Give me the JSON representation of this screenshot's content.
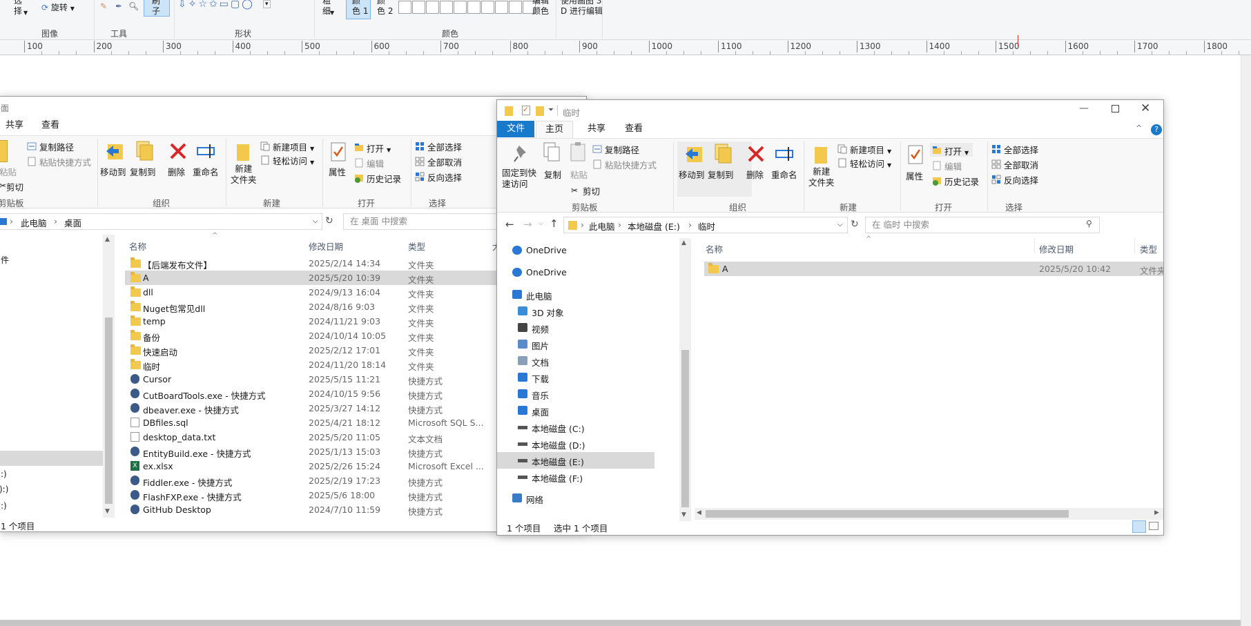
{
  "paint": {
    "select_label": "选\n择",
    "rotate_label": "旋转",
    "brush_label": "刷\n子",
    "thickness_label": "粗\n细",
    "color1_label": "颜\n色 1",
    "color2_label": "颜\n色 2",
    "edit_colors_label": "编辑\n颜色",
    "paint3d_label": "使用画图 3\nD 进行编辑",
    "groups": {
      "image": "图像",
      "tools": "工具",
      "shapes": "形状",
      "colors": "颜色"
    },
    "ruler_ticks": [
      "100",
      "200",
      "300",
      "400",
      "500",
      "600",
      "700",
      "800",
      "900",
      "1000",
      "1100",
      "1200",
      "1300",
      "1400",
      "1500",
      "1600",
      "1700",
      "1800"
    ]
  },
  "left_window": {
    "title_partial": "面",
    "tabs": [
      "共享",
      "查看"
    ],
    "ribbon": {
      "copy_path": "复制路径",
      "paste_shortcut": "粘贴快捷方式",
      "paste": "粘贴",
      "cut": "剪切",
      "clipboard_group": "剪贴板",
      "move_to": "移动到",
      "copy_to": "复制到",
      "delete": "删除",
      "rename": "重命名",
      "organize_group": "组织",
      "new_folder": "新建\n文件夹",
      "new_item": "新建项目",
      "easy_access": "轻松访问",
      "new_group": "新建",
      "properties": "属性",
      "open": "打开",
      "edit": "编辑",
      "history": "历史记录",
      "open_group": "打开",
      "select_all": "全部选择",
      "select_none": "全部取消",
      "invert_select": "反向选择",
      "select_group": "选择"
    },
    "breadcrumb": [
      "此电脑",
      "桌面"
    ],
    "search_placeholder": "在 桌面 中搜索",
    "columns": {
      "name": "名称",
      "date": "修改日期",
      "type": "类型",
      "size": "大"
    },
    "files": [
      {
        "name": "【后端发布文件】",
        "date": "2025/2/14 14:34",
        "type": "文件夹",
        "kind": "folder"
      },
      {
        "name": "A",
        "date": "2025/5/20 10:39",
        "type": "文件夹",
        "kind": "folder"
      },
      {
        "name": "dll",
        "date": "2024/9/13 16:04",
        "type": "文件夹",
        "kind": "folder"
      },
      {
        "name": "Nuget包常见dll",
        "date": "2024/8/16 9:03",
        "type": "文件夹",
        "kind": "folder"
      },
      {
        "name": "temp",
        "date": "2024/11/21 9:03",
        "type": "文件夹",
        "kind": "folder"
      },
      {
        "name": "备份",
        "date": "2024/10/14 10:05",
        "type": "文件夹",
        "kind": "folder"
      },
      {
        "name": "快速启动",
        "date": "2025/2/12 17:01",
        "type": "文件夹",
        "kind": "folder"
      },
      {
        "name": "临时",
        "date": "2024/11/20 18:14",
        "type": "文件夹",
        "kind": "folder"
      },
      {
        "name": "Cursor",
        "date": "2025/5/15 11:21",
        "type": "快捷方式",
        "kind": "shortcut"
      },
      {
        "name": "CutBoardTools.exe - 快捷方式",
        "date": "2024/10/15 9:56",
        "type": "快捷方式",
        "kind": "shortcut"
      },
      {
        "name": "dbeaver.exe - 快捷方式",
        "date": "2025/3/27 14:12",
        "type": "快捷方式",
        "kind": "shortcut"
      },
      {
        "name": "DBfiles.sql",
        "date": "2025/4/21 18:12",
        "type": "Microsoft SQL S...",
        "kind": "file"
      },
      {
        "name": "desktop_data.txt",
        "date": "2025/5/20 11:05",
        "type": "文本文档",
        "kind": "file"
      },
      {
        "name": "EntityBuild.exe - 快捷方式",
        "date": "2025/1/13 15:03",
        "type": "快捷方式",
        "kind": "shortcut"
      },
      {
        "name": "ex.xlsx",
        "date": "2025/2/26 15:24",
        "type": "Microsoft Excel ...",
        "kind": "excel"
      },
      {
        "name": "Fiddler.exe - 快捷方式",
        "date": "2025/2/19 17:23",
        "type": "快捷方式",
        "kind": "shortcut"
      },
      {
        "name": "FlashFXP.exe - 快捷方式",
        "date": "2025/5/6 18:00",
        "type": "快捷方式",
        "kind": "shortcut"
      },
      {
        "name": "GitHub Desktop",
        "date": "2024/7/10 11:59",
        "type": "快捷方式",
        "kind": "shortcut"
      }
    ],
    "nav_partial": [
      "件",
      ":)",
      "):)",
      ":)"
    ],
    "status": "1 个项目"
  },
  "right_window": {
    "title": "临时",
    "tabs": {
      "file": "文件",
      "home": "主页",
      "share": "共享",
      "view": "查看"
    },
    "ribbon": {
      "pin": "固定到快\n速访问",
      "copy": "复制",
      "paste": "粘贴",
      "copy_path": "复制路径",
      "paste_shortcut": "粘贴快捷方式",
      "cut": "剪切",
      "clipboard_group": "剪贴板",
      "move_to": "移动到",
      "copy_to": "复制到",
      "delete": "删除",
      "rename": "重命名",
      "organize_group": "组织",
      "new_folder": "新建\n文件夹",
      "new_item": "新建项目",
      "easy_access": "轻松访问",
      "new_group": "新建",
      "properties": "属性",
      "open": "打开",
      "edit": "编辑",
      "history": "历史记录",
      "open_group": "打开",
      "select_all": "全部选择",
      "select_none": "全部取消",
      "invert_select": "反向选择",
      "select_group": "选择"
    },
    "breadcrumb": [
      "此电脑",
      "本地磁盘 (E:)",
      "临时"
    ],
    "search_placeholder": "在 临时 中搜索",
    "columns": {
      "name": "名称",
      "date": "修改日期",
      "type": "类型"
    },
    "files": [
      {
        "name": "A",
        "date": "2025/5/20 10:42",
        "type": "文件夹"
      }
    ],
    "nav": [
      {
        "label": "OneDrive",
        "icon": "cloud-icon",
        "indent": 0
      },
      {
        "label": "OneDrive",
        "icon": "cloud-icon",
        "indent": 0
      },
      {
        "label": "此电脑",
        "icon": "pc-icon",
        "indent": 0
      },
      {
        "label": "3D 对象",
        "icon": "cube-icon",
        "indent": 1
      },
      {
        "label": "视频",
        "icon": "video-icon",
        "indent": 1
      },
      {
        "label": "图片",
        "icon": "picture-icon",
        "indent": 1
      },
      {
        "label": "文档",
        "icon": "document-icon",
        "indent": 1
      },
      {
        "label": "下载",
        "icon": "download-icon",
        "indent": 1
      },
      {
        "label": "音乐",
        "icon": "music-icon",
        "indent": 1
      },
      {
        "label": "桌面",
        "icon": "desktop-icon",
        "indent": 1
      },
      {
        "label": "本地磁盘 (C:)",
        "icon": "drive-icon",
        "indent": 1
      },
      {
        "label": "本地磁盘 (D:)",
        "icon": "drive-icon",
        "indent": 1
      },
      {
        "label": "本地磁盘 (E:)",
        "icon": "drive-icon",
        "indent": 1
      },
      {
        "label": "本地磁盘 (F:)",
        "icon": "drive-icon",
        "indent": 1
      },
      {
        "label": "网络",
        "icon": "network-icon",
        "indent": 0
      }
    ],
    "status_count": "1 个项目",
    "status_selected": "选中 1 个项目"
  },
  "colors": {
    "accent": "#1979ca",
    "selection": "#d9d9d9",
    "folder": "#f2c94c"
  }
}
